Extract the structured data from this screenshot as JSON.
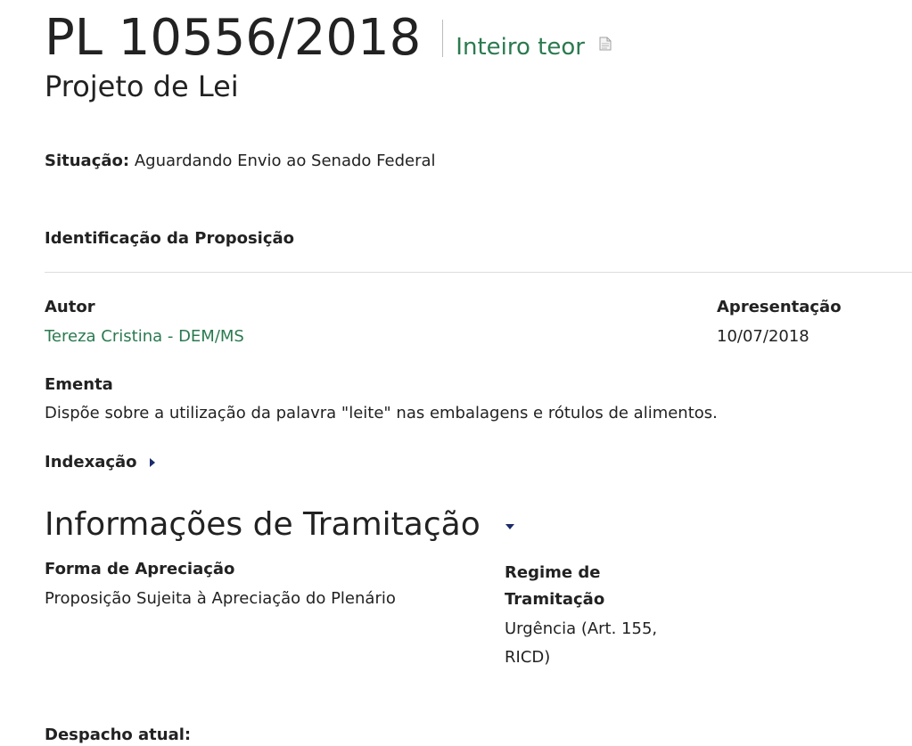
{
  "header": {
    "number": "PL 10556/2018",
    "full_text_link": "Inteiro teor",
    "full_text_icon": "document-icon",
    "type": "Projeto de Lei"
  },
  "situacao": {
    "label": "Situação:",
    "value": "Aguardando Envio ao Senado Federal"
  },
  "identificacao": {
    "heading": "Identificação da Proposição",
    "autor_label": "Autor",
    "autor_value": "Tereza Cristina - DEM/MS",
    "apresentacao_label": "Apresentação",
    "apresentacao_value": "10/07/2018",
    "ementa_label": "Ementa",
    "ementa_value": "Dispõe sobre a utilização da palavra \"leite\" nas embalagens e rótulos de alimentos.",
    "indexacao_label": "Indexação"
  },
  "tramitacao": {
    "heading": "Informações de Tramitação",
    "forma_label": "Forma de Apreciação",
    "forma_value": "Proposição Sujeita à Apreciação do Plenário",
    "regime_label": "Regime de Tramitação",
    "regime_value": "Urgência (Art. 155, RICD)",
    "despacho_label": "Despacho atual:"
  },
  "colors": {
    "link": "#2a7a4f",
    "text": "#222222",
    "caret": "#1b2b6b",
    "divider": "#dddddd"
  }
}
